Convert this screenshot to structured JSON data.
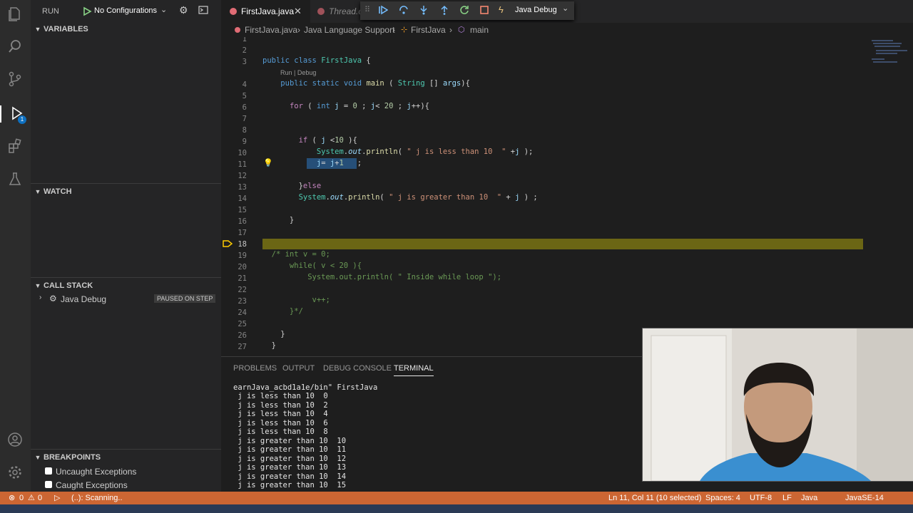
{
  "sidebar": {
    "run_label": "RUN",
    "config_label": "No Configurations",
    "variables_title": "VARIABLES",
    "watch_title": "WATCH",
    "callstack_title": "CALL STACK",
    "callstack_item": "Java Debug",
    "callstack_status": "PAUSED ON STEP",
    "breakpoints_title": "BREAKPOINTS",
    "bp_uncaught": "Uncaught Exceptions",
    "bp_caught": "Caught Exceptions"
  },
  "tabs": {
    "active": "FirstJava.java",
    "inactive": "Thread.c",
    "debug_config": "Java Debug"
  },
  "breadcrumb": {
    "file": "FirstJava.java",
    "support": "Java Language Support",
    "class": "FirstJava",
    "method": "main"
  },
  "editor": {
    "line_numbers": [
      "1",
      "2",
      "3",
      "4",
      "5",
      "6",
      "7",
      "8",
      "9",
      "10",
      "11",
      "12",
      "13",
      "14",
      "15",
      "16",
      "17",
      "18",
      "19",
      "20",
      "21",
      "22",
      "23",
      "24",
      "25",
      "26",
      "27"
    ],
    "codelens": "Run | Debug",
    "current_line": "18"
  },
  "panel": {
    "tabs": [
      "PROBLEMS",
      "OUTPUT",
      "DEBUG CONSOLE",
      "TERMINAL"
    ],
    "active_tab": "TERMINAL",
    "terminal_lines": [
      "earnJava_acbd1a1e/bin\" FirstJava",
      " j is less than 10  0",
      " j is less than 10  2",
      " j is less than 10  4",
      " j is less than 10  6",
      " j is less than 10  8",
      " j is greater than 10  10",
      " j is greater than 10  11",
      " j is greater than 10  12",
      " j is greater than 10  13",
      " j is greater than 10  14",
      " j is greater than 10  15"
    ]
  },
  "status": {
    "errors": "0",
    "warnings": "0",
    "scanning": "(..): Scanning..",
    "position": "Ln 11, Col 11 (10 selected)",
    "spaces": "Spaces: 4",
    "encoding": "UTF-8",
    "eol": "LF",
    "language": "Java",
    "runtime": "JavaSE-14"
  },
  "colors": {
    "status_bar": "#cc6633",
    "current_line": "#6b6614",
    "selection": "#264f78"
  }
}
